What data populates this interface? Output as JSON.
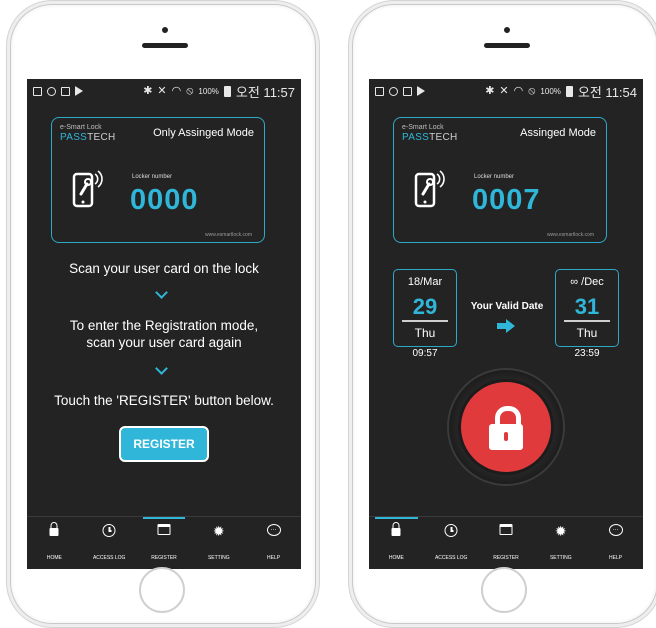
{
  "colors": {
    "accent": "#2fb6d8",
    "screen_bg": "#232323",
    "lock_red": "#e03a3d"
  },
  "left_screen": {
    "status": {
      "battery": "100%",
      "time": "오전 11:57"
    },
    "brand": {
      "line1": "e-Smart Lock",
      "line2_accent": "PASS",
      "line2_rest": "TECH"
    },
    "mode_label": "Only Assinged Mode",
    "locker_label": "Locker number",
    "locker_number": "0000",
    "site_url": "www.esmartlock.com",
    "steps": [
      "Scan your user card on the lock",
      "To enter the Registration mode,",
      "scan your user card again",
      "Touch the 'REGISTER' button below."
    ],
    "register_button": "REGISTER",
    "nav": [
      "HOME",
      "ACCESS LOG",
      "REGISTER",
      "SETTING",
      "HELP"
    ],
    "active_nav": "REGISTER"
  },
  "right_screen": {
    "status": {
      "battery": "100%",
      "time": "오전 11:54"
    },
    "brand": {
      "line1": "e-Smart Lock",
      "line2_accent": "PASS",
      "line2_rest": "TECH"
    },
    "mode_label": "Assinged Mode",
    "locker_label": "Locker number",
    "locker_number": "0007",
    "site_url": "www.esmartlock.com",
    "start": {
      "month": "18/Mar",
      "day": "29",
      "weekday": "Thu",
      "time": "09:57"
    },
    "valid_label": "Your Valid Date",
    "end": {
      "month": "∞ /Dec",
      "day": "31",
      "weekday": "Thu",
      "time": "23:59"
    },
    "nav": [
      "HOME",
      "ACCESS LOG",
      "REGISTER",
      "SETTING",
      "HELP"
    ],
    "active_nav": "HOME"
  }
}
